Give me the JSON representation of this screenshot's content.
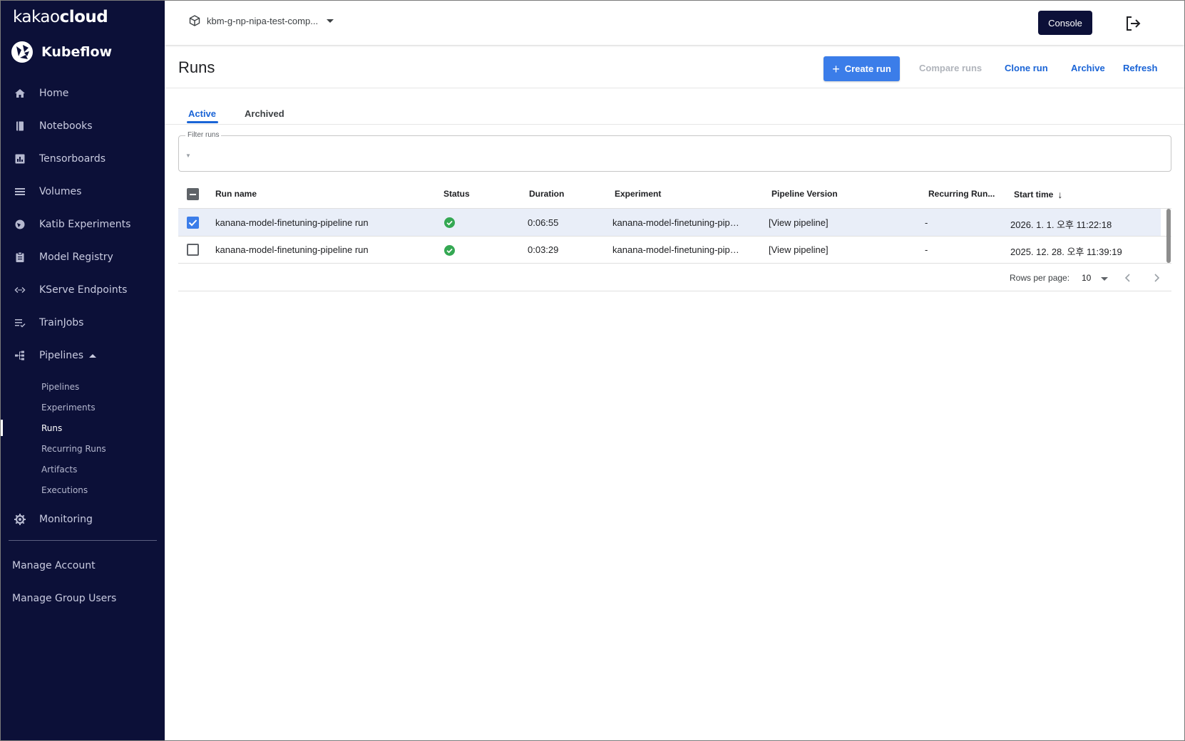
{
  "brand": {
    "kakao_light": "kakao",
    "kakao_bold": "cloud",
    "product": "Kubeflow"
  },
  "sidebar": {
    "items": [
      {
        "label": "Home",
        "icon": "home-icon"
      },
      {
        "label": "Notebooks",
        "icon": "notebook-icon"
      },
      {
        "label": "Tensorboards",
        "icon": "chart-icon"
      },
      {
        "label": "Volumes",
        "icon": "storage-icon"
      },
      {
        "label": "Katib Experiments",
        "icon": "katib-icon"
      },
      {
        "label": "Model Registry",
        "icon": "clipboard-icon"
      },
      {
        "label": "KServe Endpoints",
        "icon": "code-arrows-icon"
      },
      {
        "label": "TrainJobs",
        "icon": "list-check-icon"
      },
      {
        "label": "Pipelines",
        "icon": "pipeline-icon"
      }
    ],
    "pipelines_sub": [
      "Pipelines",
      "Experiments",
      "Runs",
      "Recurring Runs",
      "Artifacts",
      "Executions"
    ],
    "monitoring": "Monitoring",
    "manage_account": "Manage Account",
    "manage_group_users": "Manage Group Users"
  },
  "topbar": {
    "namespace": "kbm-g-np-nipa-test-comp...",
    "console": "Console"
  },
  "page": {
    "title": "Runs",
    "create_run": "Create run",
    "compare_runs": "Compare runs",
    "clone_run": "Clone run",
    "archive": "Archive",
    "refresh": "Refresh"
  },
  "tabs": {
    "active": "Active",
    "archived": "Archived"
  },
  "filter": {
    "label": "Filter runs"
  },
  "table": {
    "headers": [
      "Run name",
      "Status",
      "Duration",
      "Experiment",
      "Pipeline Version",
      "Recurring Run...",
      "Start time"
    ],
    "rows": [
      {
        "name": "kanana-model-finetuning-pipeline run",
        "duration": "0:06:55",
        "experiment": "kanana-model-finetuning-pip…",
        "pipeline": "[View pipeline]",
        "recurring": "-",
        "start": "2026. 1. 1. 오후 11:22:18",
        "status": "succeeded",
        "selected": true
      },
      {
        "name": "kanana-model-finetuning-pipeline run",
        "duration": "0:03:29",
        "experiment": "kanana-model-finetuning-pip…",
        "pipeline": "[View pipeline]",
        "recurring": "-",
        "start": "2025. 12. 28. 오후 11:39:19",
        "status": "succeeded",
        "selected": false
      }
    ]
  },
  "pagination": {
    "rows_per_page_label": "Rows per page:",
    "rows_per_page": "10"
  },
  "colors": {
    "sidebar_bg": "#0c1038",
    "primary": "#3b7de9",
    "link": "#1a64d6",
    "success": "#34a853"
  }
}
